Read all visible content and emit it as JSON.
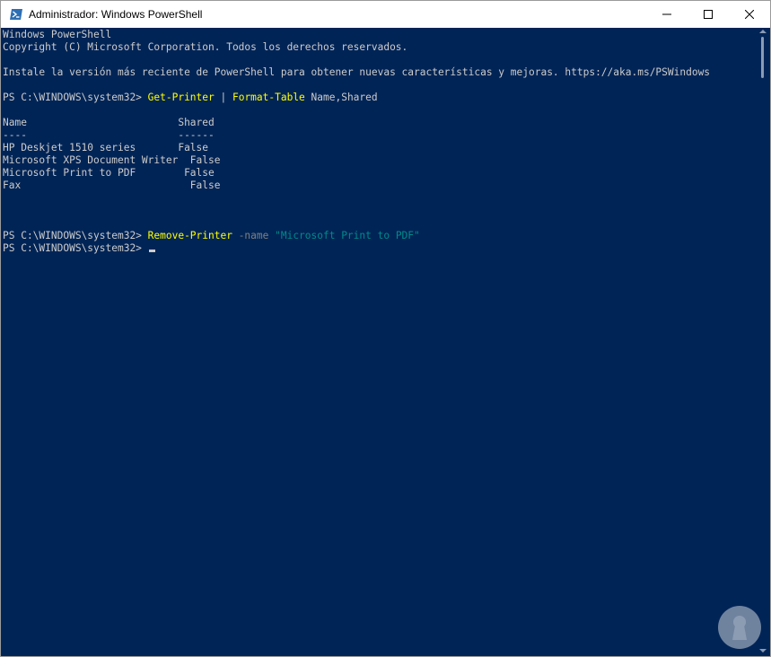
{
  "window": {
    "title": "Administrador: Windows PowerShell",
    "icon": "powershell-icon"
  },
  "controls": {
    "minimize_icon": "minimize-icon",
    "maximize_icon": "maximize-icon",
    "close_icon": "close-icon"
  },
  "console": {
    "line1": "Windows PowerShell",
    "line2": "Copyright (C) Microsoft Corporation. Todos los derechos reservados.",
    "line3": "Instale la versión más reciente de PowerShell para obtener nuevas características y mejoras. https://aka.ms/PSWindows",
    "prompt": "PS C:\\WINDOWS\\system32> ",
    "cmd1": {
      "cmdlet1": "Get-Printer",
      "pipe": " | ",
      "cmdlet2": "Format-Table",
      "args": " Name,Shared"
    },
    "table": {
      "header": "Name                         Shared",
      "separator": "----                         ------",
      "rows": [
        "HP Deskjet 1510 series       False",
        "Microsoft XPS Document Writer  False",
        "Microsoft Print to PDF        False",
        "Fax                            False"
      ]
    },
    "cmd2": {
      "cmdlet": "Remove-Printer",
      "param": " -name ",
      "value": "\"Microsoft Print to PDF\""
    }
  },
  "colors": {
    "background": "#012456",
    "text": "#cccccc",
    "command": "#ffff00",
    "parameter": "#808080",
    "string": "#008b8b"
  }
}
